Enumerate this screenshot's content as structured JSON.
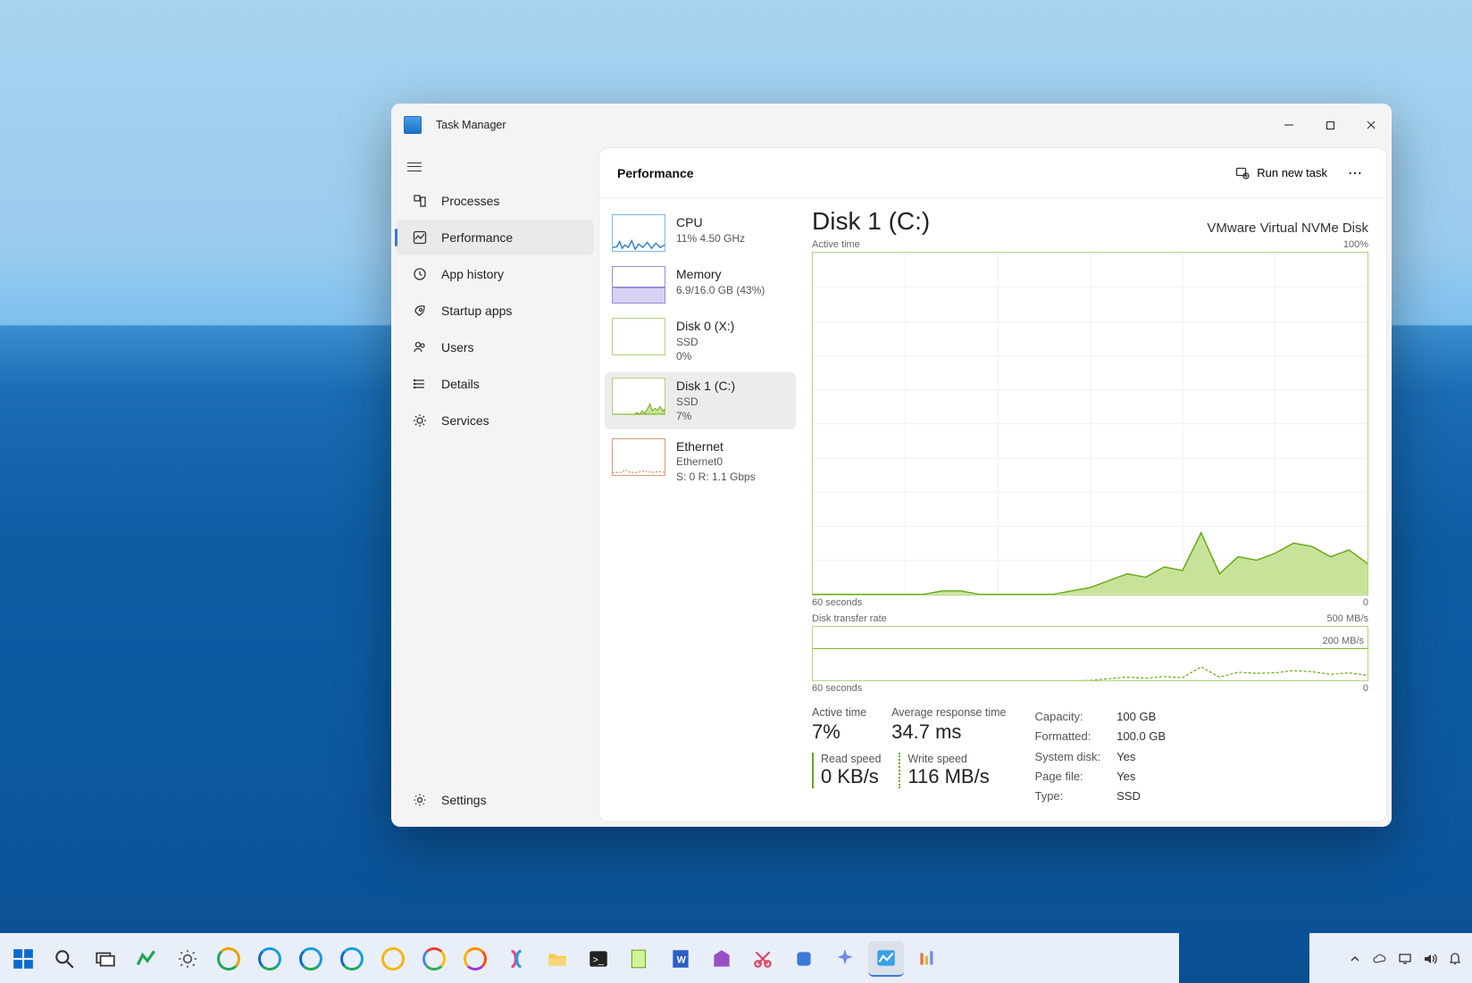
{
  "app_title": "Task Manager",
  "sidebar": {
    "items": [
      {
        "label": "Processes"
      },
      {
        "label": "Performance"
      },
      {
        "label": "App history"
      },
      {
        "label": "Startup apps"
      },
      {
        "label": "Users"
      },
      {
        "label": "Details"
      },
      {
        "label": "Services"
      }
    ],
    "settings_label": "Settings",
    "active_index": 1
  },
  "content": {
    "title": "Performance",
    "run_task_label": "Run new task"
  },
  "resources": [
    {
      "title": "CPU",
      "line1": "11%  4.50 GHz",
      "line2": ""
    },
    {
      "title": "Memory",
      "line1": "6.9/16.0 GB (43%)",
      "line2": ""
    },
    {
      "title": "Disk 0 (X:)",
      "line1": "SSD",
      "line2": "0%"
    },
    {
      "title": "Disk 1 (C:)",
      "line1": "SSD",
      "line2": "7%"
    },
    {
      "title": "Ethernet",
      "line1": "Ethernet0",
      "line2": "S: 0  R: 1.1 Gbps"
    }
  ],
  "selected_resource_index": 3,
  "detail": {
    "title": "Disk 1 (C:)",
    "device": "VMware Virtual NVMe Disk",
    "chart1": {
      "label": "Active time",
      "max": "100%",
      "x_left": "60 seconds",
      "x_right": "0"
    },
    "chart2": {
      "label": "Disk transfer rate",
      "max": "500 MB/s",
      "mid": "200 MB/s",
      "x_left": "60 seconds",
      "x_right": "0"
    },
    "stats": {
      "active_time_label": "Active time",
      "active_time_value": "7%",
      "response_label": "Average response time",
      "response_value": "34.7 ms",
      "read_label": "Read speed",
      "read_value": "0 KB/s",
      "write_label": "Write speed",
      "write_value": "116 MB/s"
    },
    "props": [
      {
        "k": "Capacity:",
        "v": "100 GB"
      },
      {
        "k": "Formatted:",
        "v": "100.0 GB"
      },
      {
        "k": "System disk:",
        "v": "Yes"
      },
      {
        "k": "Page file:",
        "v": "Yes"
      },
      {
        "k": "Type:",
        "v": "SSD"
      }
    ]
  },
  "chart_data": {
    "type": "area",
    "title": "Disk 1 (C:) — Active time (%)",
    "xlabel": "seconds ago",
    "ylabel": "Active time %",
    "x": [
      60,
      58,
      56,
      54,
      52,
      50,
      48,
      46,
      44,
      42,
      40,
      38,
      36,
      34,
      32,
      30,
      28,
      26,
      24,
      22,
      20,
      18,
      16,
      14,
      12,
      10,
      8,
      6,
      4,
      2,
      0
    ],
    "values": [
      0,
      0,
      0,
      0,
      0,
      0,
      0,
      1,
      1,
      0,
      0,
      0,
      0,
      0,
      1,
      2,
      4,
      6,
      5,
      8,
      7,
      18,
      6,
      11,
      10,
      12,
      15,
      14,
      11,
      13,
      9
    ],
    "ylim": [
      0,
      100
    ],
    "secondary": {
      "type": "line",
      "title": "Disk transfer rate (MB/s)",
      "series": [
        {
          "name": "Read",
          "values": [
            0,
            0,
            0,
            0,
            0,
            0,
            0,
            0,
            0,
            0,
            0,
            0,
            0,
            0,
            0,
            0,
            0,
            0,
            0,
            0,
            0,
            0,
            0,
            0,
            0,
            0,
            0,
            0,
            0,
            0,
            0
          ]
        },
        {
          "name": "Write",
          "values": [
            0,
            0,
            0,
            0,
            0,
            0,
            0,
            0,
            0,
            0,
            0,
            0,
            0,
            0,
            0,
            5,
            20,
            35,
            25,
            40,
            30,
            130,
            35,
            80,
            70,
            75,
            95,
            85,
            60,
            75,
            50
          ]
        }
      ],
      "ylim": [
        0,
        500
      ]
    }
  }
}
